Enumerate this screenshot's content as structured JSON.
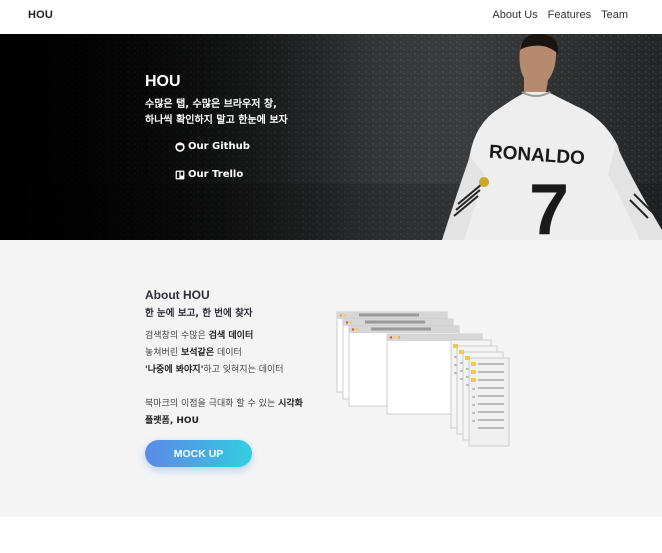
{
  "navbar": {
    "brand": "HOU",
    "links": [
      "About Us",
      "Features",
      "Team"
    ]
  },
  "hero": {
    "title": "HOU",
    "subtitle_line1": "수많은 탭, 수많은 브라우저 창,",
    "subtitle_line2": "하나씩 확인하지 말고 한눈에 보자",
    "github_label": "Our Github",
    "trello_label": "Our Trello",
    "jersey_name": "RONALDO",
    "jersey_number": "7"
  },
  "about": {
    "title": "About HOU",
    "subtitle": "한 눈에 보고, 한 번에 찾자",
    "line1_pre": "검색창의 수많은 ",
    "line1_bold": "검색 데이터",
    "line2_pre": "놓쳐버린 ",
    "line2_bold": "보석같은",
    "line2_post": " 데이터",
    "line3_bold": "'나중에 봐야지'",
    "line3_post": "하고 잊혀지는 데이터",
    "line4_pre": "북마크의 이점을 극대화 할 수 있는 ",
    "line4_bold": "시각화",
    "line5_bold": "플랫폼, HOU",
    "button_label": "MOCK UP"
  },
  "colors": {
    "button_gradient_start": "#5b8be6",
    "button_gradient_end": "#33d0e0",
    "about_bg": "#f4f4f4",
    "hero_bg": "#0b0b0c"
  }
}
